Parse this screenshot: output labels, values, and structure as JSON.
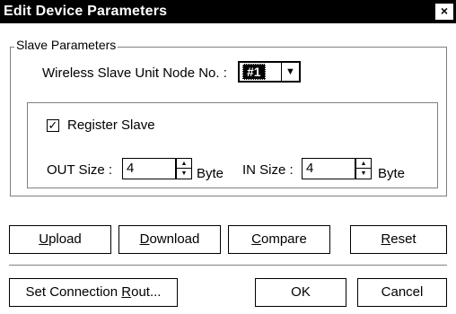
{
  "window": {
    "title": "Edit Device Parameters",
    "close_glyph": "×"
  },
  "slave_parameters": {
    "group_label": "Slave Parameters",
    "node_label": "Wireless Slave Unit Node No. :",
    "node_value": "#1",
    "register_checked": true,
    "register_label": "Register Slave",
    "out_size_label": "OUT Size :",
    "out_size_value": "4",
    "out_unit": "Byte",
    "in_size_label": "IN Size :",
    "in_size_value": "4",
    "in_unit": "Byte"
  },
  "buttons": {
    "upload": {
      "hotkey": "U",
      "rest": "pload"
    },
    "download": {
      "hotkey": "D",
      "rest": "ownload"
    },
    "compare": {
      "hotkey": "C",
      "rest": "ompare"
    },
    "reset": {
      "hotkey": "R",
      "rest": "eset"
    },
    "set_connection": {
      "prefix": "Set Connection ",
      "hotkey": "R",
      "rest": "out..."
    },
    "ok": "OK",
    "cancel": "Cancel"
  },
  "icons": {
    "combo_arrow": "chevron-down-icon",
    "checkbox_mark": "checkmark-icon",
    "spin_up": "triangle-up-icon",
    "spin_down": "triangle-down-icon"
  }
}
